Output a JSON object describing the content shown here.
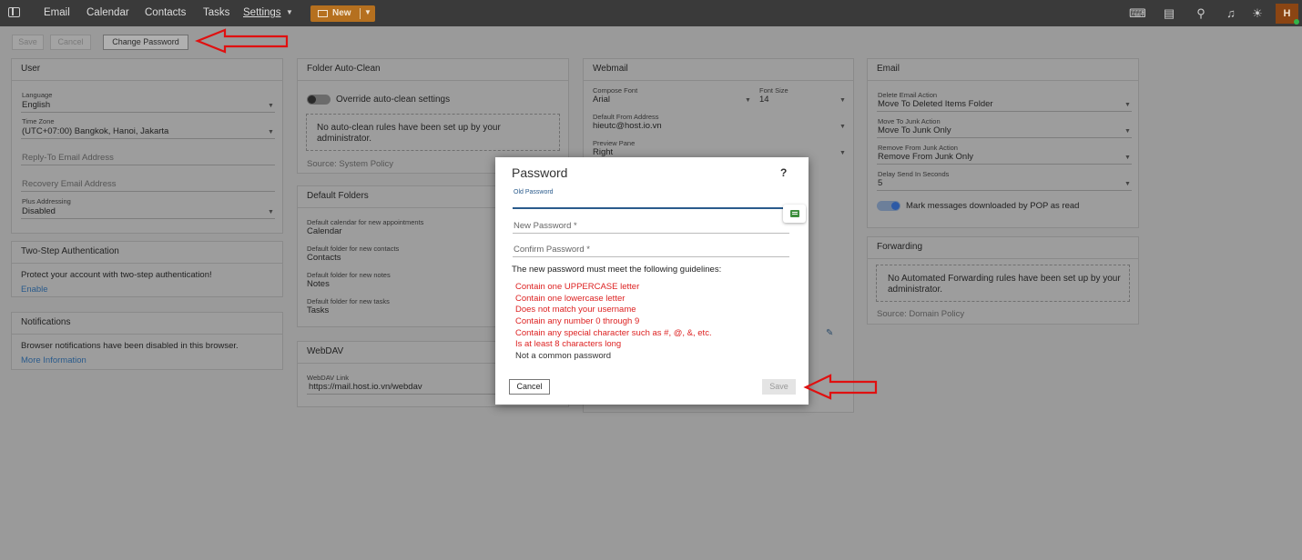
{
  "nav": {
    "items": [
      "Email",
      "Calendar",
      "Contacts",
      "Tasks",
      "Settings"
    ],
    "new_label": "New",
    "avatar": "H",
    "icons": [
      "keyboard-icon",
      "chat-icon",
      "search-icon",
      "bell-icon",
      "sun-icon"
    ]
  },
  "actions": {
    "save": "Save",
    "cancel": "Cancel",
    "change_password": "Change Password"
  },
  "user": {
    "title": "User",
    "language_label": "Language",
    "language": "English",
    "timezone_label": "Time Zone",
    "timezone": "(UTC+07:00) Bangkok, Hanoi, Jakarta",
    "reply_to": "Reply-To Email Address",
    "recovery": "Recovery Email Address",
    "plus_label": "Plus Addressing",
    "plus": "Disabled"
  },
  "two_step": {
    "title": "Two-Step Authentication",
    "text": "Protect your account with two-step authentication!",
    "link": "Enable"
  },
  "notifications": {
    "title": "Notifications",
    "text": "Browser notifications have been disabled in this browser.",
    "link": "More Information"
  },
  "auto_clean": {
    "title": "Folder Auto-Clean",
    "toggle_label": "Override auto-clean settings",
    "note": "No auto-clean rules have been set up by your administrator.",
    "source": "Source: System Policy"
  },
  "default_folders": {
    "title": "Default Folders",
    "calendar_label": "Default calendar for new appointments",
    "calendar": "Calendar",
    "contacts_label": "Default folder for new contacts",
    "contacts": "Contacts",
    "notes_label": "Default folder for new notes",
    "notes": "Notes",
    "tasks_label": "Default folder for new tasks",
    "tasks": "Tasks"
  },
  "webdav": {
    "title": "WebDAV",
    "link_label": "WebDAV Link",
    "link": "https://mail.host.io.vn/webdav"
  },
  "webmail": {
    "title": "Webmail",
    "compose_font_label": "Compose Font",
    "compose_font": "Arial",
    "font_size_label": "Font Size",
    "font_size": "14",
    "from_label": "Default From Address",
    "from": "hieutc@host.io.vn",
    "preview_label": "Preview Pane",
    "preview": "Right"
  },
  "email": {
    "title": "Email",
    "delete_label": "Delete Email Action",
    "delete": "Move To Deleted Items Folder",
    "junk_label": "Move To Junk Action",
    "junk": "Move To Junk Only",
    "remove_junk_label": "Remove From Junk Action",
    "remove_junk": "Remove From Junk Only",
    "delay_label": "Delay Send In Seconds",
    "delay": "5",
    "pop_toggle": "Mark messages downloaded by POP as read"
  },
  "forwarding": {
    "title": "Forwarding",
    "note": "No Automated Forwarding rules have been set up by your administrator.",
    "source": "Source: Domain Policy"
  },
  "modal": {
    "title": "Password",
    "help": "?",
    "old_label": "Old Password",
    "new_ph": "New Password *",
    "confirm_ph": "Confirm Password *",
    "guidelines": "The new password must meet the following guidelines:",
    "rules": [
      "Contain one UPPERCASE letter",
      "Contain one lowercase letter",
      "Does not match your username",
      "Contain any number 0 through 9",
      "Contain any special character such as #, @, &, etc.",
      "Is at least 8 characters long",
      "Not a common password"
    ],
    "cancel": "Cancel",
    "save": "Save"
  },
  "colors": {
    "accent": "#2a5b8c",
    "error": "#dd2222",
    "new_button": "#b5701f",
    "annotation_arrow": "#e01010"
  }
}
